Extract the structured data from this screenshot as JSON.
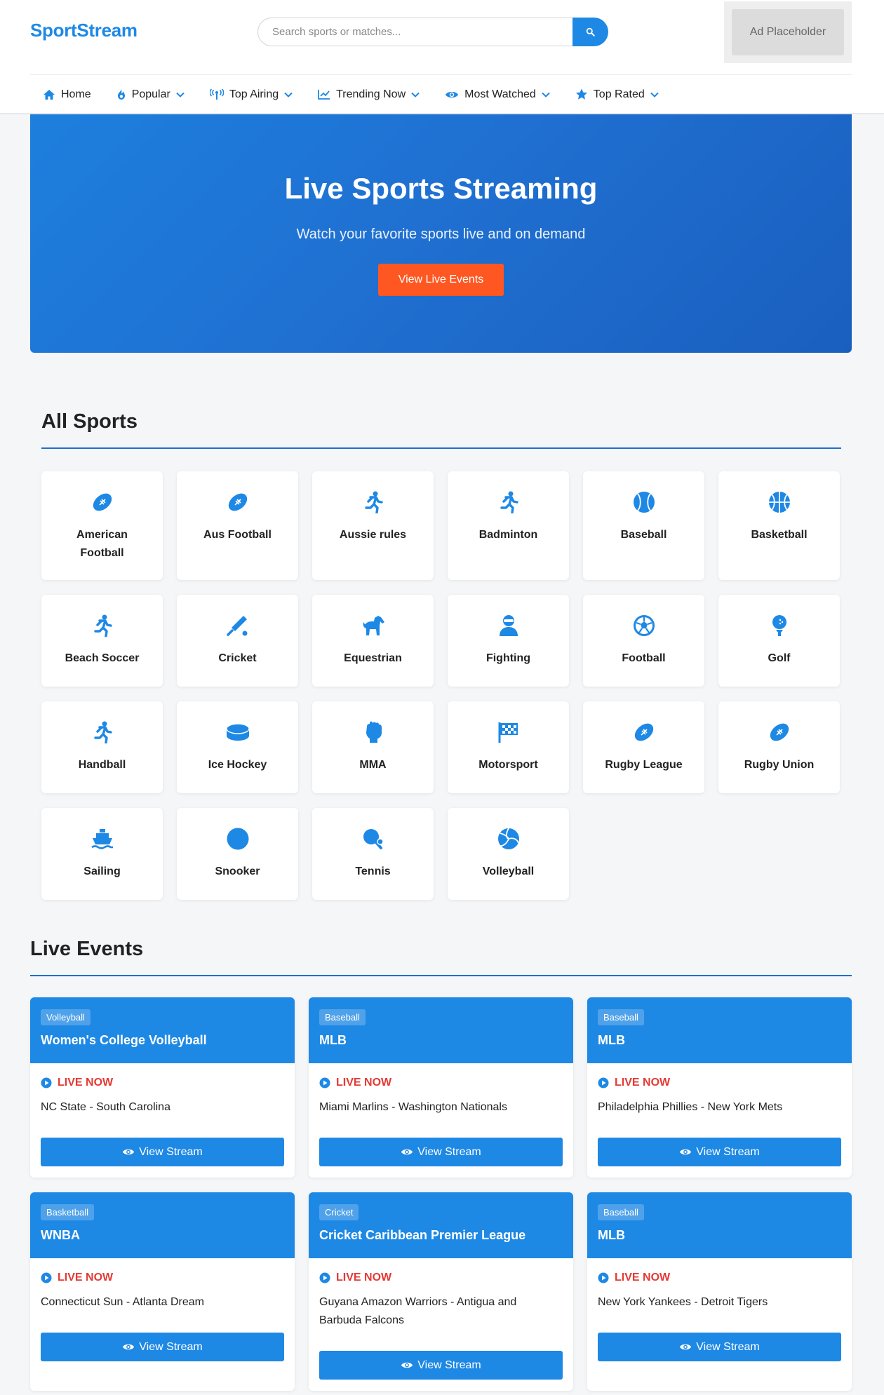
{
  "header": {
    "logo": "SportStream",
    "search_placeholder": "Search sports or matches...",
    "ad": "Ad Placeholder"
  },
  "nav": [
    {
      "label": "Home",
      "icon": "home-icon",
      "dropdown": false
    },
    {
      "label": "Popular",
      "icon": "fire-icon",
      "dropdown": true
    },
    {
      "label": "Top Airing",
      "icon": "broadcast-icon",
      "dropdown": true
    },
    {
      "label": "Trending Now",
      "icon": "chart-line-icon",
      "dropdown": true
    },
    {
      "label": "Most Watched",
      "icon": "eye-icon",
      "dropdown": true
    },
    {
      "label": "Top Rated",
      "icon": "star-icon",
      "dropdown": true
    }
  ],
  "hero": {
    "title": "Live Sports Streaming",
    "subtitle": "Watch your favorite sports live and on demand",
    "button": "View Live Events"
  },
  "sports_section": {
    "title": "All Sports",
    "items": [
      {
        "label": "American Football",
        "icon": "football-icon"
      },
      {
        "label": "Aus Football",
        "icon": "football-icon"
      },
      {
        "label": "Aussie rules",
        "icon": "running-icon"
      },
      {
        "label": "Badminton",
        "icon": "running-icon"
      },
      {
        "label": "Baseball",
        "icon": "baseball-icon"
      },
      {
        "label": "Basketball",
        "icon": "basketball-icon"
      },
      {
        "label": "Beach Soccer",
        "icon": "running-icon"
      },
      {
        "label": "Cricket",
        "icon": "cricket-bat-icon"
      },
      {
        "label": "Equestrian",
        "icon": "horse-icon"
      },
      {
        "label": "Fighting",
        "icon": "ninja-icon"
      },
      {
        "label": "Football",
        "icon": "soccer-ball-icon"
      },
      {
        "label": "Golf",
        "icon": "golf-ball-icon"
      },
      {
        "label": "Handball",
        "icon": "running-icon"
      },
      {
        "label": "Ice Hockey",
        "icon": "hockey-puck-icon"
      },
      {
        "label": "MMA",
        "icon": "fist-icon"
      },
      {
        "label": "Motorsport",
        "icon": "checkered-flag-icon"
      },
      {
        "label": "Rugby League",
        "icon": "football-icon"
      },
      {
        "label": "Rugby Union",
        "icon": "football-icon"
      },
      {
        "label": "Sailing",
        "icon": "ship-icon"
      },
      {
        "label": "Snooker",
        "icon": "circle-icon"
      },
      {
        "label": "Tennis",
        "icon": "table-tennis-icon"
      },
      {
        "label": "Volleyball",
        "icon": "volleyball-icon"
      }
    ]
  },
  "events_section": {
    "title": "Live Events",
    "live_label": "LIVE NOW",
    "button_label": "View Stream",
    "items": [
      {
        "category": "Volleyball",
        "league": "Women's College Volleyball",
        "match": "NC State - South Carolina"
      },
      {
        "category": "Baseball",
        "league": "MLB",
        "match": "Miami Marlins - Washington Nationals"
      },
      {
        "category": "Baseball",
        "league": "MLB",
        "match": "Philadelphia Phillies - New York Mets"
      },
      {
        "category": "Basketball",
        "league": "WNBA",
        "match": "Connecticut Sun - Atlanta Dream"
      },
      {
        "category": "Cricket",
        "league": "Cricket Caribbean Premier League",
        "match": "Guyana Amazon Warriors - Antigua and Barbuda Falcons"
      },
      {
        "category": "Baseball",
        "league": "MLB",
        "match": "New York Yankees - Detroit Tigers"
      }
    ]
  },
  "colors": {
    "primary": "#1e88e5",
    "accent": "#ff5722",
    "live": "#e53935"
  }
}
